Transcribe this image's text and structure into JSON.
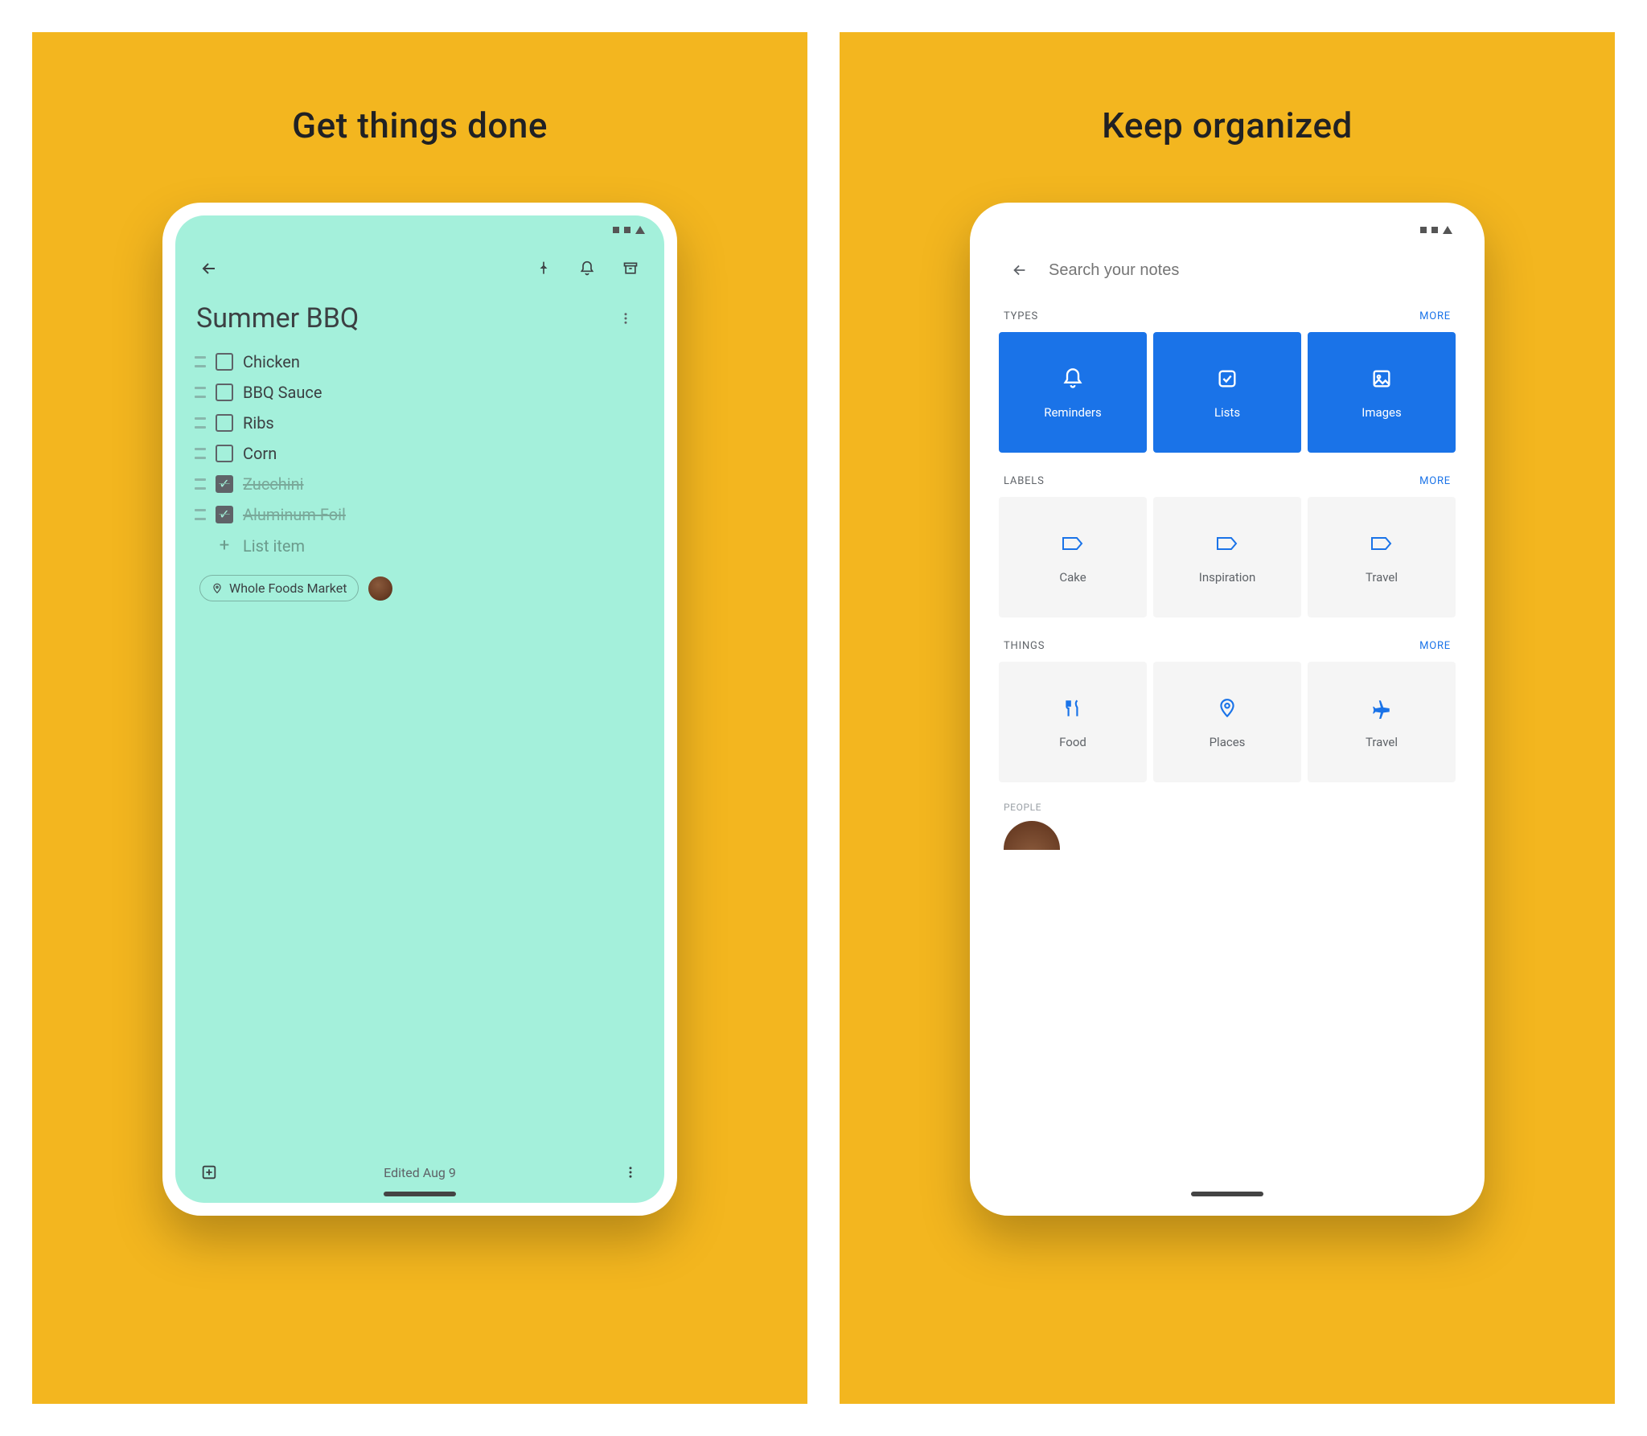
{
  "left": {
    "panel_title": "Get things done",
    "note": {
      "title": "Summer BBQ",
      "items": [
        {
          "label": "Chicken",
          "checked": false
        },
        {
          "label": "BBQ Sauce",
          "checked": false
        },
        {
          "label": "Ribs",
          "checked": false
        },
        {
          "label": "Corn",
          "checked": false
        },
        {
          "label": "Zucchini",
          "checked": true
        },
        {
          "label": "Aluminum Foil",
          "checked": true
        }
      ],
      "add_item_label": "List item",
      "location_chip": "Whole Foods Market",
      "edited_label": "Edited Aug 9"
    }
  },
  "right": {
    "panel_title": "Keep organized",
    "search_placeholder": "Search your notes",
    "sections": {
      "types": {
        "header": "TYPES",
        "more": "MORE",
        "tiles": [
          {
            "label": "Reminders",
            "icon": "bell"
          },
          {
            "label": "Lists",
            "icon": "check"
          },
          {
            "label": "Images",
            "icon": "image"
          }
        ]
      },
      "labels": {
        "header": "LABELS",
        "more": "MORE",
        "tiles": [
          {
            "label": "Cake",
            "icon": "tag"
          },
          {
            "label": "Inspiration",
            "icon": "tag"
          },
          {
            "label": "Travel",
            "icon": "tag"
          }
        ]
      },
      "things": {
        "header": "THINGS",
        "more": "MORE",
        "tiles": [
          {
            "label": "Food",
            "icon": "fork"
          },
          {
            "label": "Places",
            "icon": "pin"
          },
          {
            "label": "Travel",
            "icon": "plane"
          }
        ]
      },
      "people": {
        "header": "PEOPLE"
      }
    }
  }
}
